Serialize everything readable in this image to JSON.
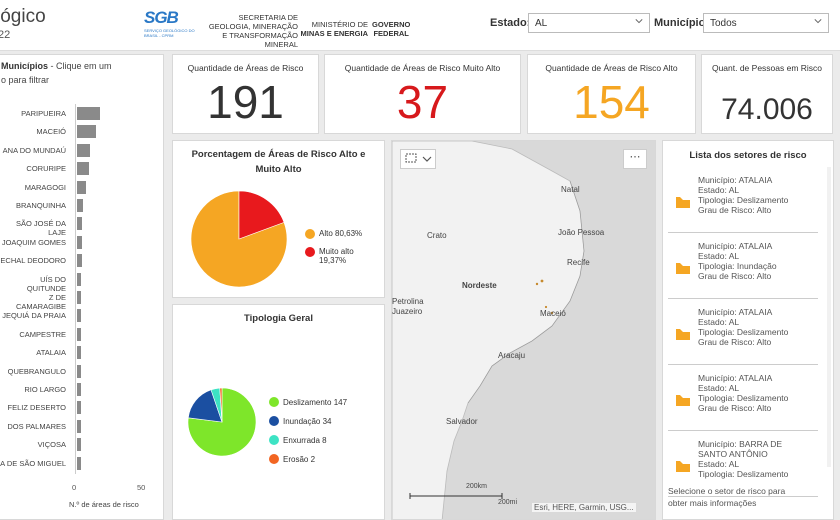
{
  "header": {
    "title": "lógico",
    "subtitle": "22",
    "sgb_logo": {
      "big": "SGB",
      "small": "SERVIÇO GEOLÓGICO DO BRASIL - CPRM"
    },
    "org_secretaria": [
      "SECRETARIA DE",
      "GEOLOGIA, MINERAÇÃO",
      "E TRANSFORMAÇÃO MINERAL"
    ],
    "org_ministerio": [
      "MINISTÉRIO DE",
      "MINAS E ENERGIA"
    ],
    "org_governo": [
      "GOVERNO",
      "FEDERAL"
    ],
    "estado_label": "Estado:",
    "estado_value": "AL",
    "municipio_label": "Município:",
    "municipio_value": "Todos"
  },
  "kpis": [
    {
      "title": "Quantidade de Áreas de Risco",
      "value": "191",
      "color": "#333333"
    },
    {
      "title": "Quantidade de Áreas de Risco Muito Alto",
      "value": "37",
      "color": "#d7191c"
    },
    {
      "title": "Quantidade de Áreas de Risco Alto",
      "value": "154",
      "color": "#f5a623"
    },
    {
      "title": "Quant. de Pessoas em Risco",
      "value": "74.006",
      "color": "#333333"
    }
  ],
  "municipios_panel": {
    "title_line1": "Municípios",
    "title_hint": "- Clique em um",
    "title_line2": "o para filtrar",
    "x_axis_label": "N.º de áreas de risco",
    "x_ticks": [
      "0",
      "50"
    ],
    "bar_color": "#8a8a8a"
  },
  "chart_data": [
    {
      "type": "bar",
      "orientation": "horizontal",
      "categories": [
        "PARIPUEIRA",
        "MACEIÓ",
        "ANA DO MUNDAÚ",
        "CORURIPE",
        "MARAGOGI",
        "BRANQUINHA",
        "SÃO JOSÉ DA LAJE",
        "JOAQUIM GOMES",
        "ECHAL DEODORO",
        "UÍS DO QUITUNDE",
        "Z DE CAMARAGIBE",
        "JEQUIÁ DA PRAIA",
        "CAMPESTRE",
        "ATALAIA",
        "QUEBRANGULO",
        "RIO LARGO",
        "FELIZ DESERTO",
        "DOS PALMARES",
        "VIÇOSA",
        "A DE SÃO MIGUEL"
      ],
      "values": [
        18,
        15,
        10,
        9,
        7,
        5,
        4,
        4,
        4,
        3,
        3,
        3,
        3,
        3,
        3,
        3,
        3,
        3,
        3,
        3
      ],
      "xlabel": "N.º de áreas de risco",
      "xlim": [
        0,
        50
      ]
    },
    {
      "type": "pie",
      "title": "Porcentagem de Áreas de Risco Alto e Muito Alto",
      "labels": [
        "Alto",
        "Muito alto"
      ],
      "values": [
        80.63,
        19.37
      ],
      "value_labels": [
        "80,63%",
        "19,37%"
      ],
      "colors": [
        "#f5a623",
        "#e8191d"
      ],
      "legend": "right"
    },
    {
      "type": "pie",
      "title": "Tipologia Geral",
      "labels": [
        "Deslizamento",
        "Inundação",
        "Enxurrada",
        "Erosão"
      ],
      "values": [
        147,
        34,
        8,
        2
      ],
      "colors": [
        "#7ee62a",
        "#1b4fa1",
        "#3de3c4",
        "#f26522"
      ],
      "legend": "right"
    }
  ],
  "map": {
    "labels": [
      "Natal",
      "João Pessoa",
      "Crato",
      "Recife",
      "Nordeste",
      "Petrolina",
      "Juazeiro",
      "Maceió",
      "Aracaju",
      "Salvador"
    ],
    "scale_km": "200km",
    "scale_mi": "200mi",
    "attribution": "Esri, HERE, Garmin, USG..."
  },
  "risk_list": {
    "title": "Lista dos setores de risco",
    "icon_color": "#f5a623",
    "items": [
      {
        "lines": [
          "Município: ATALAIA",
          "Estado: AL",
          "Tipologia: Deslizamento",
          "Grau de Risco: Alto"
        ]
      },
      {
        "lines": [
          "Município: ATALAIA",
          "Estado: AL",
          "Tipologia: Inundação",
          "Grau de Risco: Alto"
        ]
      },
      {
        "lines": [
          "Município: ATALAIA",
          "Estado: AL",
          "Tipologia: Deslizamento",
          "Grau de Risco: Alto"
        ]
      },
      {
        "lines": [
          "Município: ATALAIA",
          "Estado: AL",
          "Tipologia: Deslizamento",
          "Grau de Risco: Alto"
        ]
      },
      {
        "lines": [
          "Município: BARRA DE",
          "SANTO ANTÔNIO",
          "Estado: AL",
          "Tipologia: Deslizamento"
        ]
      }
    ],
    "footer": [
      "Selecione o setor de risco para",
      "obter mais informações"
    ]
  }
}
